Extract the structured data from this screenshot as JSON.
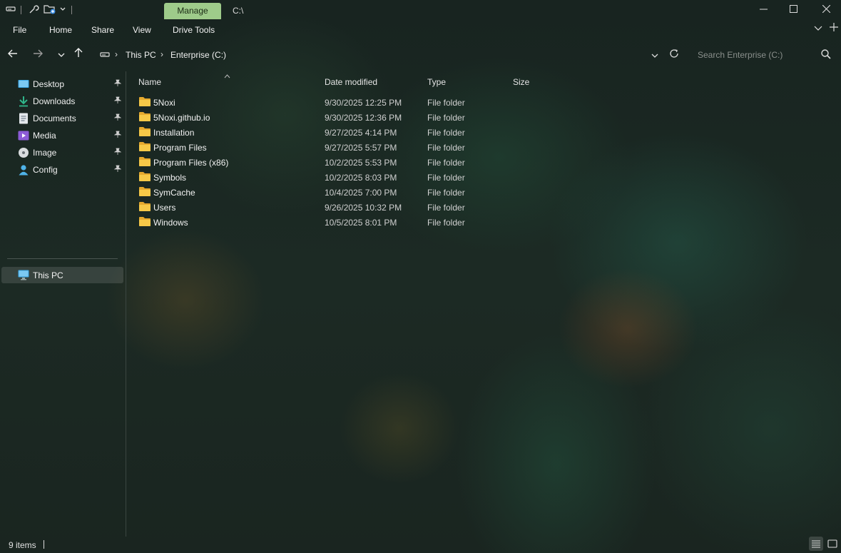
{
  "titlebar": {
    "context_tab": "Manage",
    "path": "C:\\",
    "icons": [
      "drive-icon",
      "properties-icon",
      "new-folder-icon",
      "chevron-down-icon",
      "minimize-icon",
      "maximize-icon",
      "close-icon"
    ]
  },
  "ribbon": {
    "tabs": [
      "File",
      "Home",
      "Share",
      "View",
      "Drive Tools"
    ],
    "right_icons": [
      "expand-ribbon-icon",
      "add-tab-icon"
    ]
  },
  "navigation": {
    "breadcrumbs": [
      "This PC",
      "Enterprise (C:)"
    ],
    "search_placeholder": "Search Enterprise (C:)"
  },
  "sidebar": {
    "pinned": [
      {
        "label": "Desktop",
        "icon": "desktop-icon"
      },
      {
        "label": "Downloads",
        "icon": "downloads-icon"
      },
      {
        "label": "Documents",
        "icon": "documents-icon"
      },
      {
        "label": "Media",
        "icon": "media-icon"
      },
      {
        "label": "Image",
        "icon": "disc-icon"
      },
      {
        "label": "Config",
        "icon": "user-icon"
      }
    ],
    "this_pc": "This PC"
  },
  "columns": {
    "name": "Name",
    "date": "Date modified",
    "type": "Type",
    "size": "Size"
  },
  "files": [
    {
      "name": "5Noxi",
      "date": "9/30/2025 12:25 PM",
      "type": "File folder",
      "size": ""
    },
    {
      "name": "5Noxi.github.io",
      "date": "9/30/2025 12:36 PM",
      "type": "File folder",
      "size": ""
    },
    {
      "name": "Installation",
      "date": "9/27/2025 4:14 PM",
      "type": "File folder",
      "size": ""
    },
    {
      "name": "Program Files",
      "date": "9/27/2025 5:57 PM",
      "type": "File folder",
      "size": ""
    },
    {
      "name": "Program Files (x86)",
      "date": "10/2/2025 5:53 PM",
      "type": "File folder",
      "size": ""
    },
    {
      "name": "Symbols",
      "date": "10/2/2025 8:03 PM",
      "type": "File folder",
      "size": ""
    },
    {
      "name": "SymCache",
      "date": "10/4/2025 7:00 PM",
      "type": "File folder",
      "size": ""
    },
    {
      "name": "Users",
      "date": "9/26/2025 10:32 PM",
      "type": "File folder",
      "size": ""
    },
    {
      "name": "Windows",
      "date": "10/5/2025 8:01 PM",
      "type": "File folder",
      "size": ""
    }
  ],
  "status": {
    "item_count": "9 items"
  },
  "colors": {
    "manage_tab": "#9ecb8a",
    "folder": "#f5c542"
  }
}
